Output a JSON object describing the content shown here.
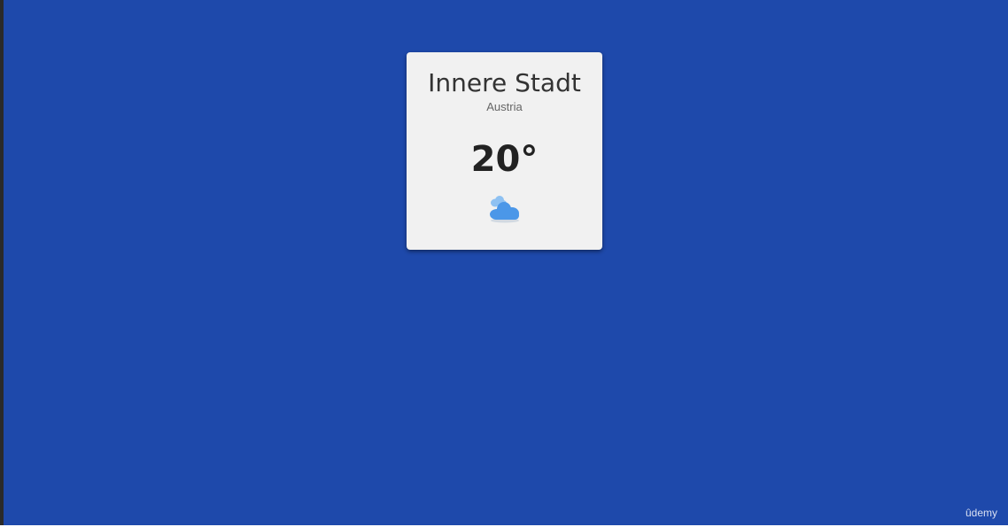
{
  "weather_card": {
    "city": "Innere Stadt",
    "country": "Austria",
    "temperature": "20°",
    "condition_icon": "partly-cloudy-icon"
  },
  "watermark": "ûdemy",
  "colors": {
    "background": "#1e49ab",
    "card": "#f1f1f1",
    "icon_blue": "#4b97e8",
    "icon_light_blue": "#8ec1f2"
  }
}
